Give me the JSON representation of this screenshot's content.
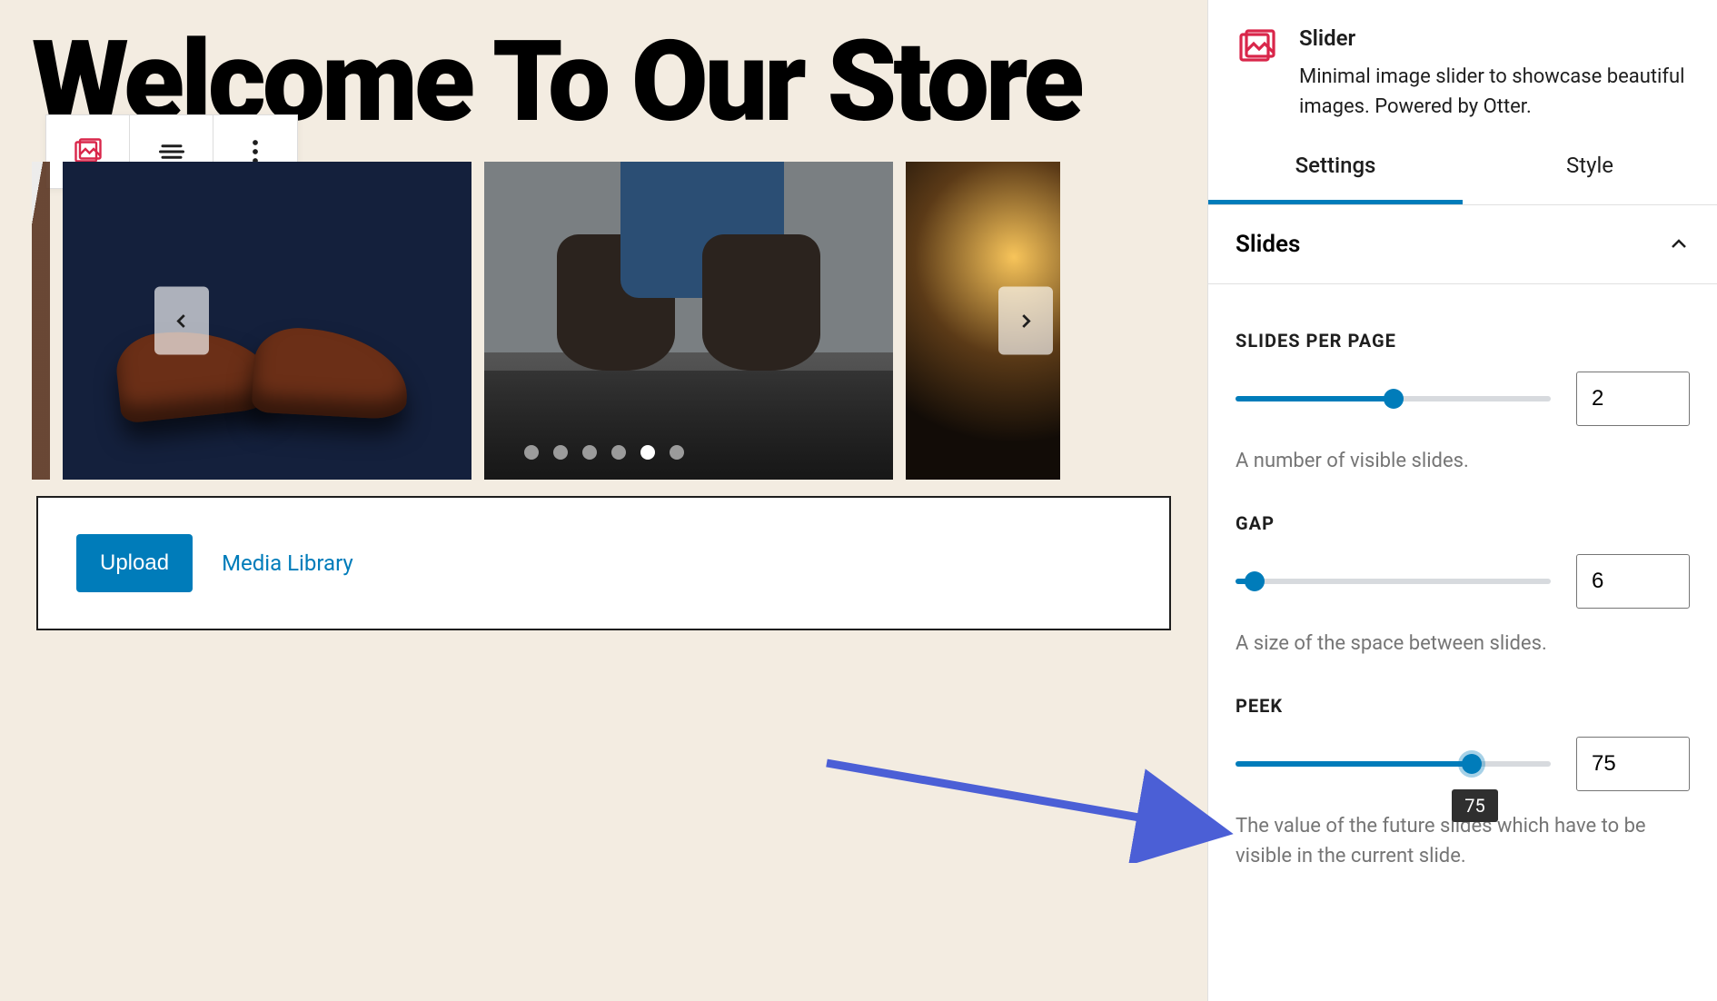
{
  "page": {
    "title": "Welcome To Our Store"
  },
  "toolbar": {
    "icons": [
      "slider-block-icon",
      "align-icon",
      "more-icon"
    ]
  },
  "slider": {
    "dots_total": 6,
    "active_dot_index": 4
  },
  "uploader": {
    "upload_label": "Upload",
    "media_library_label": "Media Library"
  },
  "sidebar": {
    "block_name": "Slider",
    "block_description": "Minimal image slider to showcase beautiful images. Powered by Otter.",
    "tabs": {
      "settings": "Settings",
      "style": "Style",
      "active": "settings"
    },
    "panel": {
      "title": "Slides",
      "expanded": true
    },
    "controls": {
      "slides_per_page": {
        "label": "SLIDES PER PAGE",
        "value": "2",
        "percent": 50,
        "help": "A number of visible slides."
      },
      "gap": {
        "label": "GAP",
        "value": "6",
        "percent": 6,
        "help": "A size of the space between slides."
      },
      "peek": {
        "label": "PEEK",
        "value": "75",
        "percent": 75,
        "tooltip": "75",
        "help": "The value of the future slides which have to be visible in the current slide."
      }
    }
  }
}
